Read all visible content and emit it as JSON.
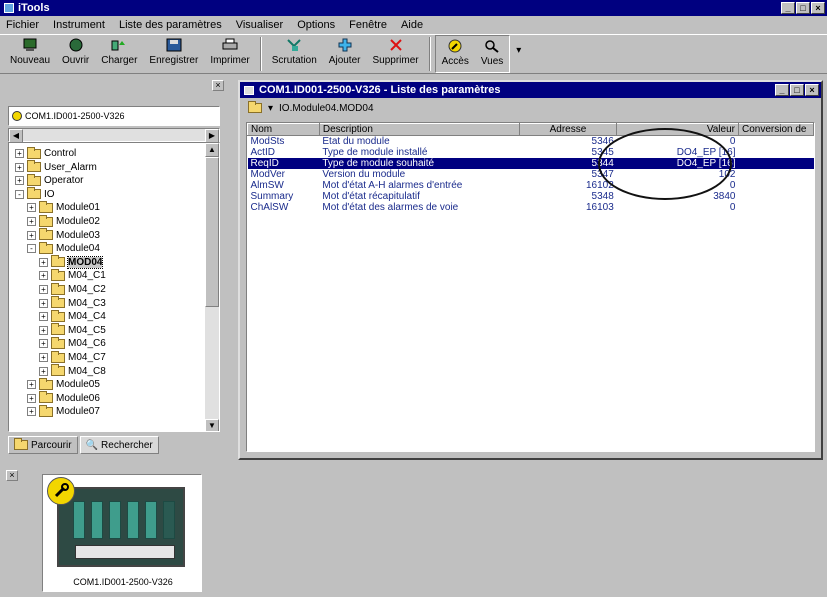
{
  "app": {
    "title": "iTools"
  },
  "menu": [
    "Fichier",
    "Instrument",
    "Liste des paramètres",
    "Visualiser",
    "Options",
    "Fenêtre",
    "Aide"
  ],
  "toolbar": {
    "buttons": [
      "Nouveau",
      "Ouvrir",
      "Charger",
      "Enregistrer",
      "Imprimer",
      "Scrutation",
      "Ajouter",
      "Supprimer",
      "Accès",
      "Vues"
    ]
  },
  "left_panel": {
    "device_combo": "COM1.ID001-2500-V326",
    "tree": [
      {
        "label": "Control",
        "exp": "+"
      },
      {
        "label": "User_Alarm",
        "exp": "+"
      },
      {
        "label": "Operator",
        "exp": "+"
      },
      {
        "label": "IO",
        "exp": "-"
      },
      {
        "label": "Module01",
        "exp": "+"
      },
      {
        "label": "Module02",
        "exp": "+"
      },
      {
        "label": "Module03",
        "exp": "+"
      },
      {
        "label": "Module04",
        "exp": "-"
      },
      {
        "label": "MOD04",
        "exp": "+"
      },
      {
        "label": "M04_C1",
        "exp": "+"
      },
      {
        "label": "M04_C2",
        "exp": "+"
      },
      {
        "label": "M04_C3",
        "exp": "+"
      },
      {
        "label": "M04_C4",
        "exp": "+"
      },
      {
        "label": "M04_C5",
        "exp": "+"
      },
      {
        "label": "M04_C6",
        "exp": "+"
      },
      {
        "label": "M04_C7",
        "exp": "+"
      },
      {
        "label": "M04_C8",
        "exp": "+"
      },
      {
        "label": "Module05",
        "exp": "+"
      },
      {
        "label": "Module06",
        "exp": "+"
      },
      {
        "label": "Module07",
        "exp": "+"
      }
    ],
    "tabs": [
      "Parcourir",
      "Rechercher"
    ]
  },
  "list_window": {
    "title": "COM1.ID001-2500-V326 - Liste des paramètres",
    "path": "IO.Module04.MOD04",
    "columns": [
      "Nom",
      "Description",
      "Adresse",
      "Valeur",
      "Conversion de"
    ],
    "rows": [
      {
        "name": "ModSts",
        "desc": "Etat du module",
        "addr": "5346",
        "value": "0"
      },
      {
        "name": "ActID",
        "desc": "Type de module installé",
        "addr": "5345",
        "value": "DO4_EP [16]"
      },
      {
        "name": "ReqID",
        "desc": "Type de module souhaité",
        "addr": "5344",
        "value": "DO4_EP [16]"
      },
      {
        "name": "ModVer",
        "desc": "Version du module",
        "addr": "5347",
        "value": "102"
      },
      {
        "name": "AlmSW",
        "desc": "Mot d'état A-H alarmes d'entrée",
        "addr": "16102",
        "value": "0"
      },
      {
        "name": "Summary",
        "desc": "Mot d'état récapitulatif",
        "addr": "5348",
        "value": "3840"
      },
      {
        "name": "ChAlSW",
        "desc": "Mot d'état des alarmes de voie",
        "addr": "16103",
        "value": "0"
      }
    ]
  },
  "bottom_panel": {
    "device_label": "COM1.ID001-2500-V326"
  }
}
